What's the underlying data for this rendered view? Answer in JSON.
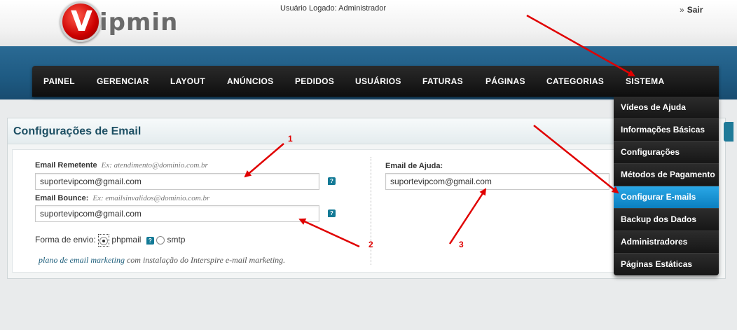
{
  "header": {
    "logo_initial": "V",
    "logo_rest": "ipmin",
    "logged_user": "Usuário Logado: Administrador",
    "logout_chevron": "»",
    "logout_label": "Sair"
  },
  "nav": {
    "items": [
      "PAINEL",
      "GERENCIAR",
      "LAYOUT",
      "ANÚNCIOS",
      "PEDIDOS",
      "USUÁRIOS",
      "FATURAS",
      "PÁGINAS",
      "CATEGORIAS",
      "SISTEMA"
    ]
  },
  "dropdown": {
    "items": [
      "Vídeos de Ajuda",
      "Informações Básicas",
      "Configurações",
      "Métodos de Pagamento",
      "Configurar E-mails",
      "Backup dos Dados",
      "Administradores",
      "Páginas Estáticas"
    ],
    "active_index": 4
  },
  "panel": {
    "title": "Configurações de Email"
  },
  "form": {
    "sender_label": "Email Remetente",
    "sender_hint": "Ex: atendimento@dominio.com.br",
    "sender_value": "suportevipcom@gmail.com",
    "bounce_label": "Email Bounce:",
    "bounce_hint": "Ex: emailsinvalidos@dominio.com.br",
    "bounce_value": "suportevipcom@gmail.com",
    "help_label": "Email de Ajuda:",
    "help_value": "suportevipcom@gmail.com",
    "send_method_label": "Forma de envio:",
    "option_phpmail": "phpmail",
    "option_smtp": "smtp",
    "selected_option": "phpmail",
    "promo_link": "plano de email marketing",
    "promo_text": " com instalação do Interspire e-mail marketing."
  },
  "annotations": {
    "label_1": "1",
    "label_2": "2",
    "label_3": "3",
    "color": "#e00000"
  },
  "colors": {
    "nav_blue": "#1e5a82",
    "active_blue": "#1a93d6",
    "title_color": "#1d4f63"
  }
}
